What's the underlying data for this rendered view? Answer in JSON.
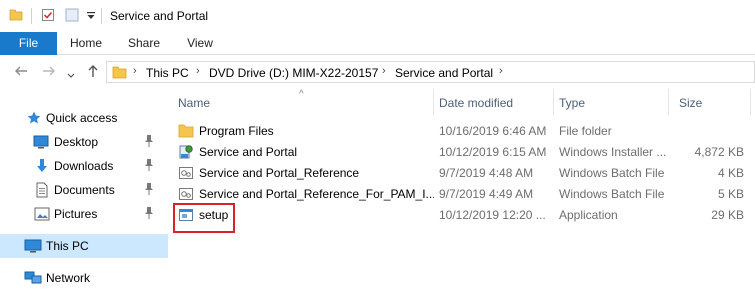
{
  "window": {
    "title": "Service and Portal"
  },
  "ribbon": {
    "tabs": [
      "File",
      "Home",
      "Share",
      "View"
    ]
  },
  "address": {
    "crumbs": [
      "This PC",
      "DVD Drive (D:) MIM-X22-20157",
      "Service and Portal"
    ]
  },
  "nav": {
    "items": [
      {
        "label": "Quick access",
        "icon": "star-icon"
      },
      {
        "label": "Desktop",
        "icon": "desktop-icon",
        "pinned": true
      },
      {
        "label": "Downloads",
        "icon": "downloads-icon",
        "pinned": true
      },
      {
        "label": "Documents",
        "icon": "documents-icon",
        "pinned": true
      },
      {
        "label": "Pictures",
        "icon": "pictures-icon",
        "pinned": true
      },
      {
        "label": "This PC",
        "icon": "computer-icon",
        "selected": true
      },
      {
        "label": "Network",
        "icon": "network-icon"
      }
    ]
  },
  "columns": {
    "name": "Name",
    "date": "Date modified",
    "type": "Type",
    "size": "Size"
  },
  "files": [
    {
      "name": "Program Files",
      "date": "10/16/2019 6:46 AM",
      "type": "File folder",
      "size": "",
      "icon": "folder-icon"
    },
    {
      "name": "Service and Portal",
      "date": "10/12/2019 6:15 AM",
      "type": "Windows Installer ...",
      "size": "4,872 KB",
      "icon": "installer-icon"
    },
    {
      "name": "Service and Portal_Reference",
      "date": "9/7/2019 4:48 AM",
      "type": "Windows Batch File",
      "size": "4 KB",
      "icon": "batch-file-icon"
    },
    {
      "name": "Service and Portal_Reference_For_PAM_I...",
      "date": "9/7/2019 4:49 AM",
      "type": "Windows Batch File",
      "size": "5 KB",
      "icon": "batch-file-icon"
    },
    {
      "name": "setup",
      "date": "10/12/2019 12:20 ...",
      "type": "Application",
      "size": "29 KB",
      "icon": "application-icon"
    }
  ],
  "colors": {
    "accent": "#1979ca",
    "selection": "#cce8ff",
    "highlight": "#d9232a",
    "folder": "#f4c54f"
  }
}
